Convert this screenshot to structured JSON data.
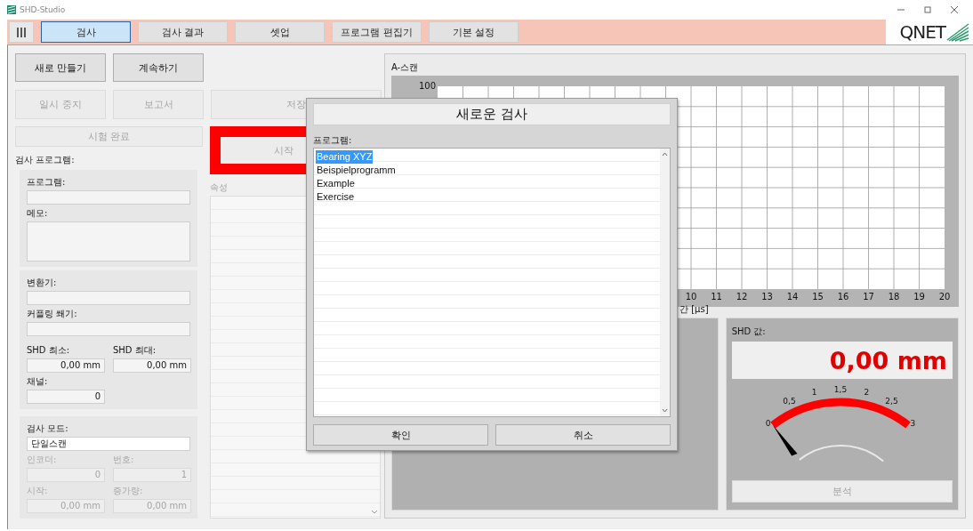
{
  "window": {
    "title": "SHD-Studio"
  },
  "tabs": [
    {
      "label": "검사",
      "selected": true
    },
    {
      "label": "검사 결과",
      "selected": false
    },
    {
      "label": "셋업",
      "selected": false
    },
    {
      "label": "프로그램 편집기",
      "selected": false
    },
    {
      "label": "기본 설정",
      "selected": false
    }
  ],
  "logo": {
    "text": "QNET"
  },
  "buttons": [
    {
      "label": "새로 만들기",
      "disabled": false
    },
    {
      "label": "계속하기",
      "disabled": false
    },
    {
      "label": "일시 중지",
      "disabled": true
    },
    {
      "label": "보고서",
      "disabled": true
    },
    {
      "label": "저장",
      "disabled": true
    },
    {
      "label": "시험 완료",
      "disabled": true
    }
  ],
  "start_button": {
    "label": "시작",
    "disabled": true,
    "highlighted": true
  },
  "inspection_program": {
    "title": "검사 프로그램:",
    "program": {
      "label": "프로그램:"
    },
    "memo": {
      "label": "메모:"
    }
  },
  "probe": {
    "transducer": {
      "label": "변환기:"
    },
    "wedge": {
      "label": "커플링 쐐기:"
    },
    "shd_min": {
      "label": "SHD 최소:",
      "value": "0,00 mm"
    },
    "shd_max": {
      "label": "SHD 최대:",
      "value": "0,00 mm"
    },
    "channel": {
      "label": "채널:",
      "value": "0"
    }
  },
  "mode": {
    "label": "검사 모드:",
    "value": "단일스캔",
    "encoder": {
      "label": "인코더:",
      "value": "0",
      "disabled": true
    },
    "number": {
      "label": "번호:",
      "value": "1",
      "disabled": true
    },
    "start": {
      "label": "시작:",
      "value": "0,00 mm",
      "disabled": true
    },
    "increment": {
      "label": "증가량:",
      "value": "0,00 mm",
      "disabled": true
    }
  },
  "properties": {
    "title": "속성",
    "disabled": true
  },
  "a_scan": {
    "title": "A-스캔",
    "y_ticks": [
      "100"
    ],
    "x_ticks": [
      "10",
      "11",
      "12",
      "13",
      "14",
      "15",
      "16",
      "17",
      "18",
      "19",
      "20"
    ],
    "x_label": "간 [µs]"
  },
  "shd_value": {
    "title": "SHD 값:",
    "reading": "0,00 mm",
    "gauge": {
      "level": 0,
      "labels": [
        "0",
        "0,5",
        "1",
        "1,5",
        "2",
        "2,5",
        "3"
      ]
    },
    "analyze": {
      "label": "분석",
      "disabled": true
    }
  },
  "dialog": {
    "title": "새로운 검사",
    "list_label": "프로그램:",
    "programs": [
      {
        "name": "Bearing XYZ",
        "selected": true
      },
      {
        "name": "Beispielprogramm",
        "selected": false
      },
      {
        "name": "Example",
        "selected": false
      },
      {
        "name": "Exercise",
        "selected": false
      }
    ],
    "buttons": [
      {
        "label": "확인"
      },
      {
        "label": "취소"
      }
    ]
  }
}
